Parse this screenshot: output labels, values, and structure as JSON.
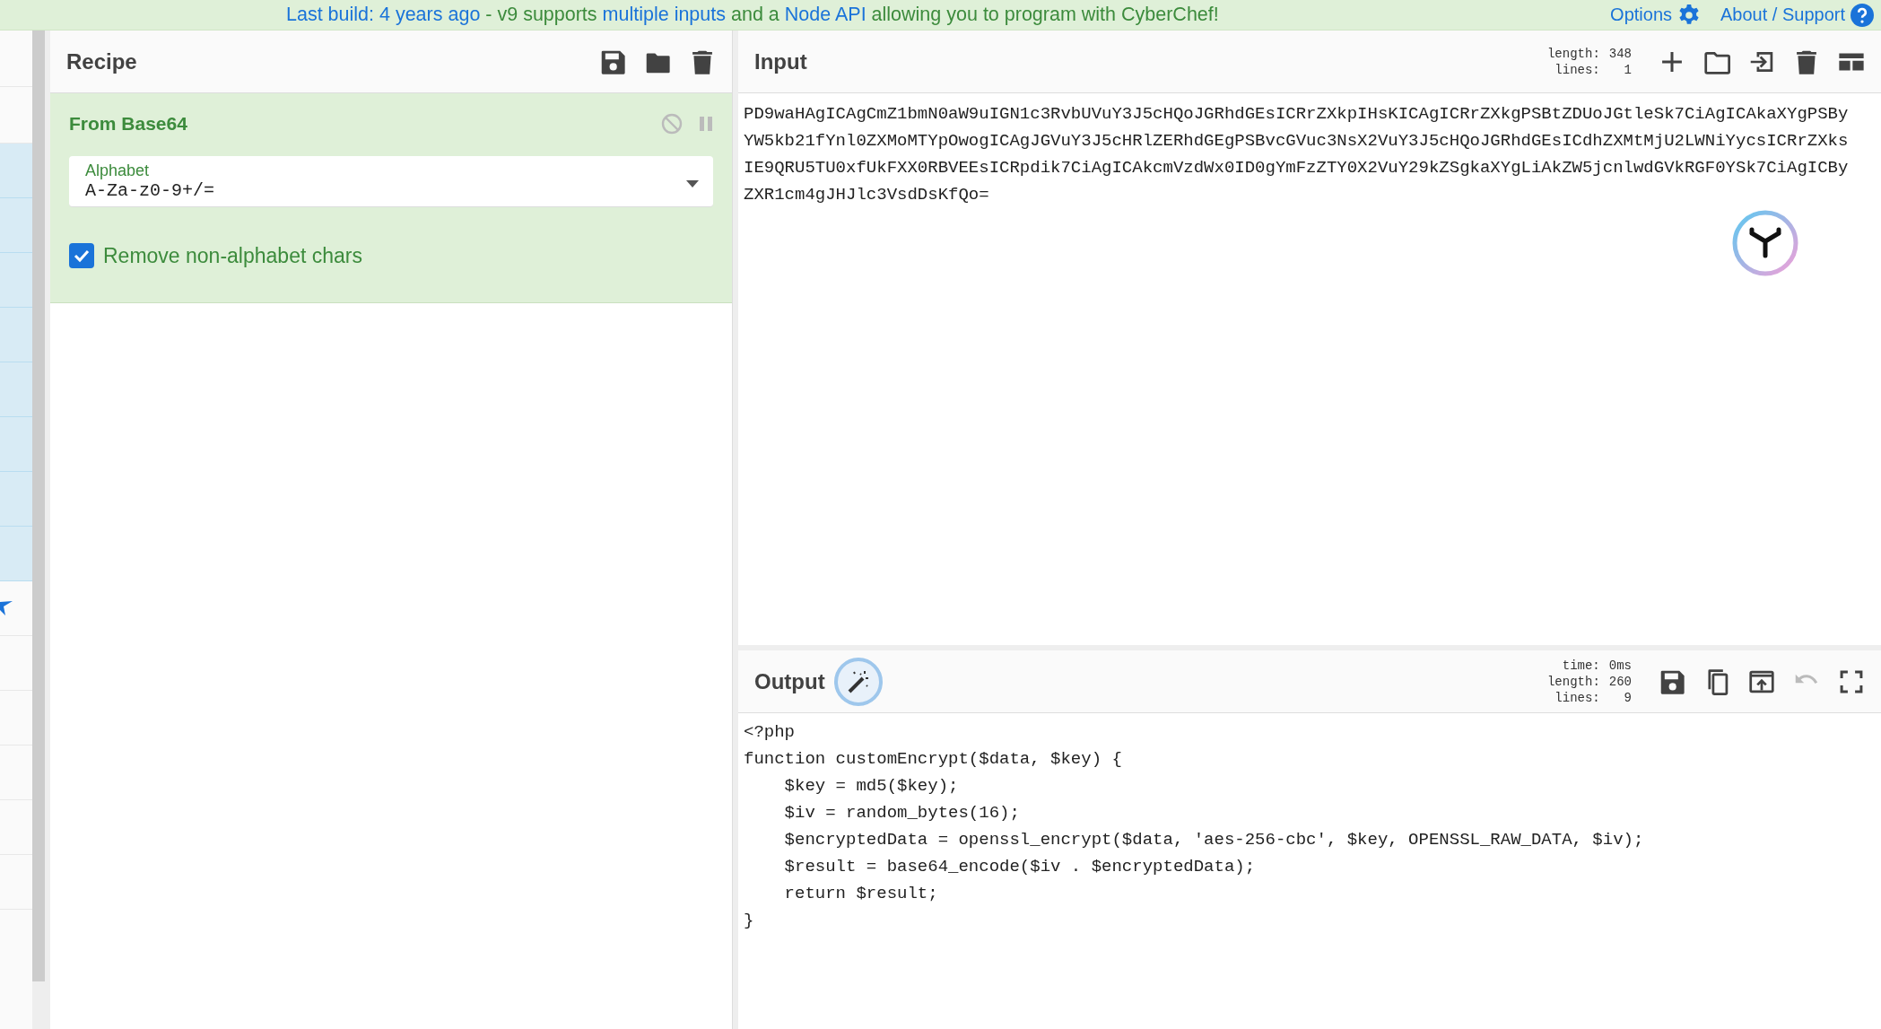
{
  "banner": {
    "parts": [
      {
        "text": "Last build: 4 years ago",
        "link": true
      },
      {
        "text": " - v9 supports ",
        "link": false
      },
      {
        "text": "multiple inputs",
        "link": true
      },
      {
        "text": " and a ",
        "link": false
      },
      {
        "text": "Node API",
        "link": true
      },
      {
        "text": " allowing you to program with CyberChef!",
        "link": false
      }
    ],
    "links": [
      {
        "label": "Options",
        "kind": "gear"
      },
      {
        "label": "About / Support",
        "kind": "help"
      }
    ]
  },
  "recipe": {
    "title": "Recipe",
    "operations": [
      {
        "name": "From Base64",
        "disabled": false,
        "paused": false,
        "field": {
          "label": "Alphabet",
          "value": "A-Za-z0-9+/="
        },
        "checkbox": {
          "label": "Remove non-alphabet chars",
          "checked": true
        }
      }
    ]
  },
  "input": {
    "title": "Input",
    "stats": [
      {
        "label": "length:",
        "value": "348"
      },
      {
        "label": "lines:",
        "value": "1"
      }
    ],
    "toolbar": [
      {
        "kind": "add",
        "disabled": false
      },
      {
        "kind": "open",
        "disabled": false
      },
      {
        "kind": "import",
        "disabled": false
      },
      {
        "kind": "delete",
        "disabled": false
      },
      {
        "kind": "layout",
        "disabled": false
      }
    ],
    "text": "PD9waHAgICAgCmZ1bmN0aW9uIGN1c3RvbUVuY3J5cHQoJGRhdGEsICRrZXkpIHsKICAgICRrZXkgPSBtZDUoJGtleSk7CiAgICAkaXYgPSByYW5kb21fYnl0ZXMoMTYpOwogICAgJGVuY3J5cHRlZERhdGEgPSBvcGVuc3NsX2VuY3J5cHQoJGRhdGEsICdhZXMtMjU2LWNiYycsICRrZXksIE9QRU5TU0xfUkFXX0RBVEEsICRpdik7CiAgICAkcmVzdWx0ID0gYmFzZTY0X2VuY29kZSgkaXYgLiAkZW5jcnlwdGVkRGF0YSk7CiAgICByZXR1cm4gJHJlc3VsdDsKfQo="
  },
  "output": {
    "title": "Output",
    "stats": [
      {
        "label": "time:",
        "value": "0ms"
      },
      {
        "label": "length:",
        "value": "260"
      },
      {
        "label": "lines:",
        "value": "9"
      }
    ],
    "toolbar": [
      {
        "kind": "save",
        "disabled": false
      },
      {
        "kind": "copy",
        "disabled": false
      },
      {
        "kind": "replace-input",
        "disabled": false
      },
      {
        "kind": "undo",
        "disabled": true
      },
      {
        "kind": "fullscreen",
        "disabled": false
      }
    ],
    "lines": [
      "<?php",
      "function customEncrypt($data, $key) {",
      "    $key = md5($key);",
      "    $iv = random_bytes(16);",
      "    $encryptedData = openssl_encrypt($data, 'aes-256-cbc', $key, OPENSSL_RAW_DATA, $iv);",
      "    $result = base64_encode($iv . $encryptedData);",
      "    return $result;",
      "}"
    ]
  }
}
